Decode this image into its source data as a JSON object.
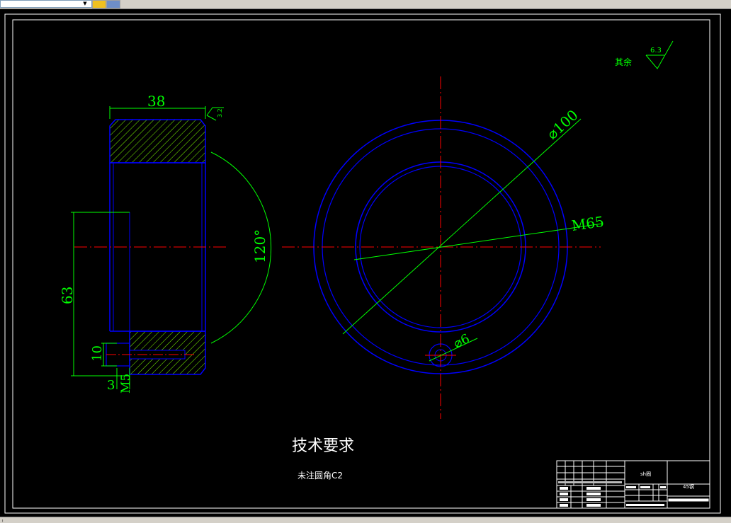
{
  "colors": {
    "background": "#000000",
    "frame": "#ffffff",
    "outline": "#0000ff",
    "center_line": "#ff0000",
    "dimension": "#00ff00",
    "hatch": "#7fff00",
    "text": "#ffffff"
  },
  "surface_note": {
    "label": "其余",
    "roughness": "6.3",
    "side_roughness": "3.2"
  },
  "side_view": {
    "width_dim": "38",
    "height_dim": "63",
    "bore_dim": "10",
    "offset_dim": "3",
    "thread_dim": "M5",
    "angle_dim": "120°"
  },
  "front_view": {
    "outer_dia": "⌀100",
    "thread_dia": "M65",
    "hole_dia": "⌀6"
  },
  "tech_requirements": {
    "title": "技术要求",
    "note": "未注圆角C2"
  },
  "title_block": {
    "part_name": "sh圈",
    "material": "45钢"
  },
  "toolbar": {
    "dropdown_icon": "chevron-down-icon"
  }
}
